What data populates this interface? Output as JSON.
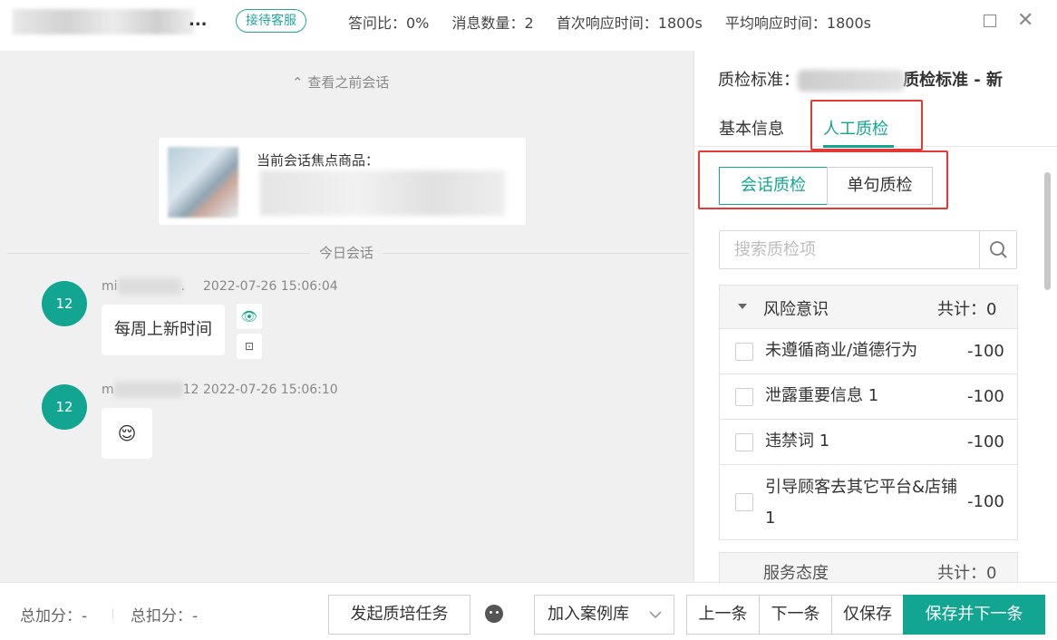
{
  "header": {
    "name_tail": "...",
    "badge": "接待客服",
    "stats": [
      "答问比：0%",
      "消息数量：2",
      "首次响应时间：1800s",
      "平均响应时间：1800s"
    ],
    "maximize_icon": "maximize-icon",
    "close_icon": "close-icon",
    "close_glyph": "✕"
  },
  "chat": {
    "prev_link": "⌃ 查看之前会话",
    "product_label": "当前会话焦点商品：",
    "today_label": "今日会话",
    "messages": [
      {
        "avatar": "12",
        "name_prefix": "mi",
        "name_suffix": ".",
        "time": "2022-07-26 15:06:04",
        "text": "每周上新时间"
      },
      {
        "avatar": "12",
        "name_prefix": "m",
        "name_suffix": "12",
        "time": "2022-07-26 15:06:10",
        "text": "😌"
      }
    ],
    "eye_glyph": "👁",
    "feedback_glyph": "⊡"
  },
  "right": {
    "standard_prefix": "质检标准：",
    "standard_suffix": "质检标准 - 新",
    "tabs": [
      "基本信息",
      "人工质检"
    ],
    "segments": [
      "会话质检",
      "单句质检"
    ],
    "search_placeholder": "搜索质检项",
    "group": {
      "title": "风险意识",
      "count": "共计：0",
      "items": [
        {
          "label": "未遵循商业/道德行为",
          "score": "-100"
        },
        {
          "label": "泄露重要信息 1",
          "score": "-100"
        },
        {
          "label": "违禁词 1",
          "score": "-100"
        },
        {
          "label": "引导顾客去其它平台&店铺 1",
          "score": "-100"
        }
      ]
    },
    "group2": {
      "title": "服务态度",
      "count": "共计：0"
    }
  },
  "footer": {
    "total_add": "总加分：-",
    "total_sub": "总扣分：-",
    "btn_training": "发起质培任务",
    "btn_case": "加入案例库",
    "btn_prev": "上一条",
    "btn_next": "下一条",
    "btn_save": "仅保存",
    "btn_save_next": "保存并下一条"
  },
  "colors": {
    "accent": "#12a591",
    "highlight_box": "#e53935"
  }
}
